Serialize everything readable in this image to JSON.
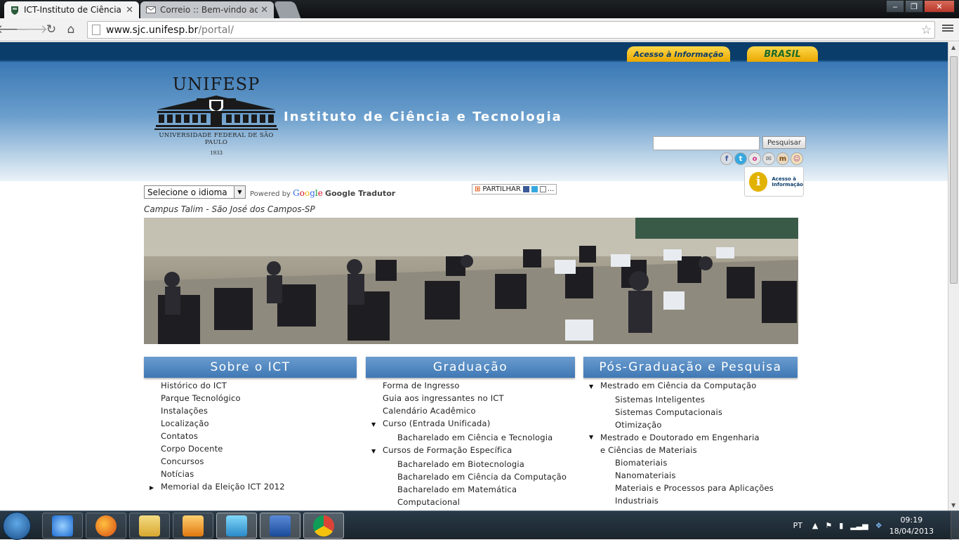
{
  "browser": {
    "tabs": [
      {
        "title": "ICT-Instituto de Ciência e",
        "icon": "unifesp-shield-icon",
        "active": true
      },
      {
        "title": "Correio :: Bem-vindo ao H",
        "icon": "mail-icon",
        "active": false
      }
    ],
    "address": {
      "host": "www.sjc.unifesp.br",
      "path": "/portal/"
    },
    "window_buttons": {
      "minimize": "‒",
      "maximize": "❐",
      "close": "✕"
    }
  },
  "page": {
    "gov_bar": {
      "access_info": "Acesso à Informação",
      "brasil": "BRASIL"
    },
    "logo": {
      "name": "UNIFESP",
      "subtitle": "UNIVERSIDADE FEDERAL DE SÃO PAULO",
      "year": "1933"
    },
    "site_title": "Instituto de Ciência e Tecnologia",
    "search": {
      "button": "Pesquisar",
      "value": ""
    },
    "social_icons": [
      "facebook-icon",
      "twitter-icon",
      "orkut-icon",
      "email-icon",
      "multiply-icon",
      "flickr-icon"
    ],
    "ai_badge": {
      "letter": "i",
      "line1": "Acesso à",
      "line2": "Informação"
    },
    "translate": {
      "select_value": "Selecione o idioma",
      "powered": "Powered by",
      "google": "Google",
      "tradutor": "Google Tradutor"
    },
    "share": {
      "label": "PARTILHAR",
      "more": "..."
    },
    "campus": "Campus Talim - São José dos Campos-SP",
    "columns": [
      {
        "heading": "Sobre o ICT",
        "items": [
          {
            "label": "Histórico do ICT"
          },
          {
            "label": "Parque Tecnológico"
          },
          {
            "label": "Instalações"
          },
          {
            "label": "Localização"
          },
          {
            "label": "Contatos"
          },
          {
            "label": "Corpo Docente"
          },
          {
            "label": "Concursos"
          },
          {
            "label": "Notícias"
          },
          {
            "label": "Memorial da Eleição ICT 2012",
            "toggle": "collapsed"
          }
        ]
      },
      {
        "heading": "Graduação",
        "items": [
          {
            "label": "Forma de Ingresso"
          },
          {
            "label": "Guia aos ingressantes no ICT"
          },
          {
            "label": "Calendário Acadêmico"
          },
          {
            "label": "Curso (Entrada Unificada)",
            "toggle": "expanded"
          },
          {
            "label": "Bacharelado em Ciência e Tecnologia",
            "sub": true
          },
          {
            "label": "Cursos de Formação Específica",
            "toggle": "expanded"
          },
          {
            "label": "Bacharelado em Biotecnologia",
            "sub": true
          },
          {
            "label": "Bacharelado em Ciência da Computação",
            "sub": true
          },
          {
            "label": "Bacharelado em Matemática Computacional",
            "sub": true
          }
        ]
      },
      {
        "heading": "Pós-Graduação e Pesquisa",
        "items": [
          {
            "label": "Mestrado em Ciência da Computação",
            "toggle": "expanded"
          },
          {
            "label": "Sistemas Inteligentes",
            "sub": true
          },
          {
            "label": "Sistemas Computacionais",
            "sub": true
          },
          {
            "label": "Otimização",
            "sub": true
          },
          {
            "label": "Mestrado e Doutorado em Engenharia e Ciências de Materiais",
            "toggle": "expanded"
          },
          {
            "label": "Biomateriais",
            "sub": true
          },
          {
            "label": "Nanomateriais",
            "sub": true
          },
          {
            "label": "Materiais e Processos para Aplicações Industriais",
            "sub": true
          }
        ]
      }
    ]
  },
  "taskbar": {
    "apps": [
      "internet-explorer-icon",
      "firefox-icon",
      "file-explorer-icon",
      "media-player-icon",
      "messenger-icon",
      "word-icon",
      "chrome-icon"
    ],
    "language": "PT",
    "time": "09:19",
    "date": "18/04/2013"
  },
  "colors": {
    "gov_blue": "#0b3d6b",
    "header_blue": "#3a78b4",
    "col_heading": "#4f86c0",
    "gov_yellow": "#ffd84a"
  }
}
